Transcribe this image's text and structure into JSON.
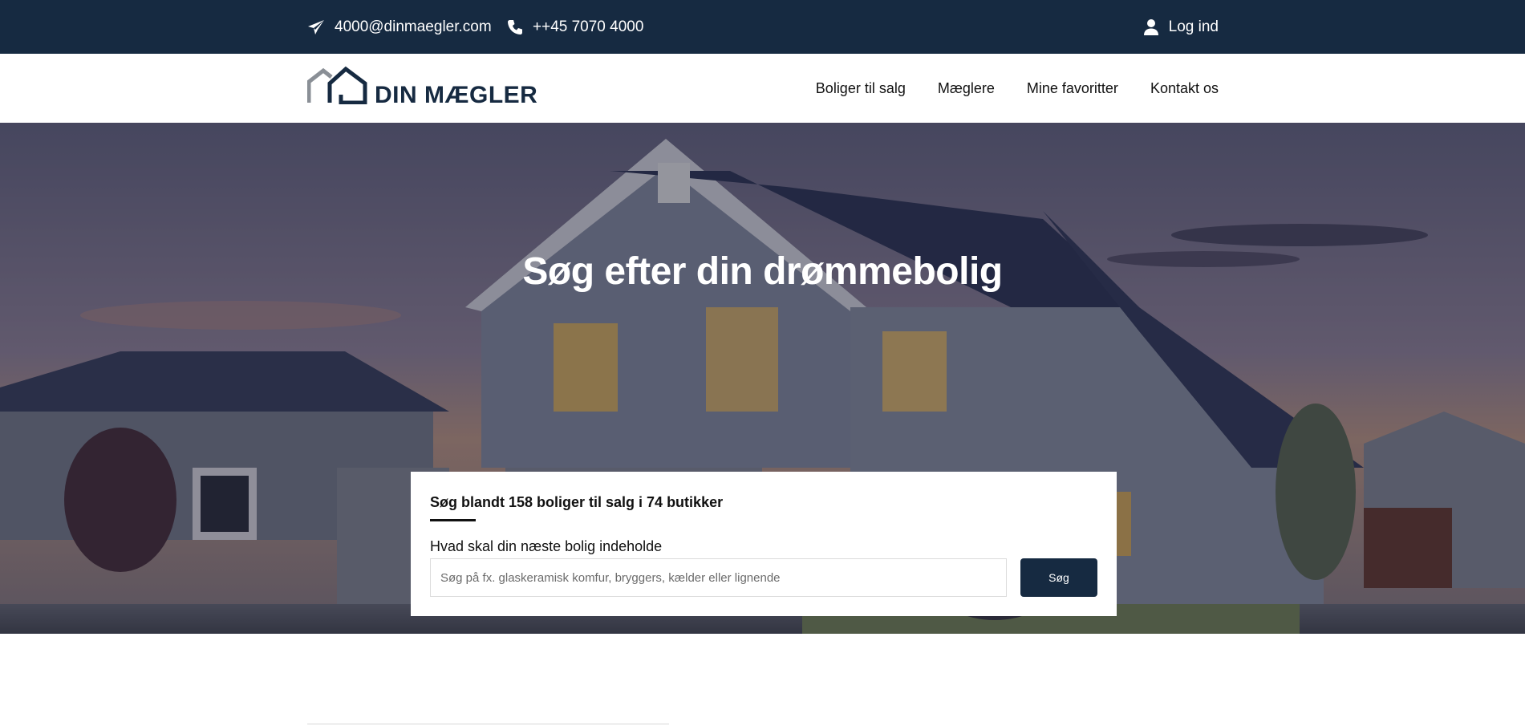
{
  "topbar": {
    "email": "4000@dinmaegler.com",
    "email_icon": "paper-plane-icon",
    "phone": "++45 7070 4000",
    "phone_icon": "phone-icon",
    "login_label": "Log ind",
    "login_icon": "user-icon",
    "background": "#162a41"
  },
  "header": {
    "logo_text": "DIN MÆGLER",
    "nav": [
      {
        "label": "Boliger til salg"
      },
      {
        "label": "Mæglere"
      },
      {
        "label": "Mine favoritter"
      },
      {
        "label": "Kontakt os"
      }
    ]
  },
  "hero": {
    "title": "Søg efter din drømmebolig"
  },
  "search": {
    "heading": "Søg blandt 158 boliger til salg i 74 butikker",
    "label": "Hvad skal din næste bolig indeholde",
    "placeholder": "Søg på fx. glaskeramisk komfur, bryggers, kælder eller lignende",
    "button_label": "Søg"
  },
  "colors": {
    "brand_dark": "#162a41",
    "white": "#ffffff"
  }
}
